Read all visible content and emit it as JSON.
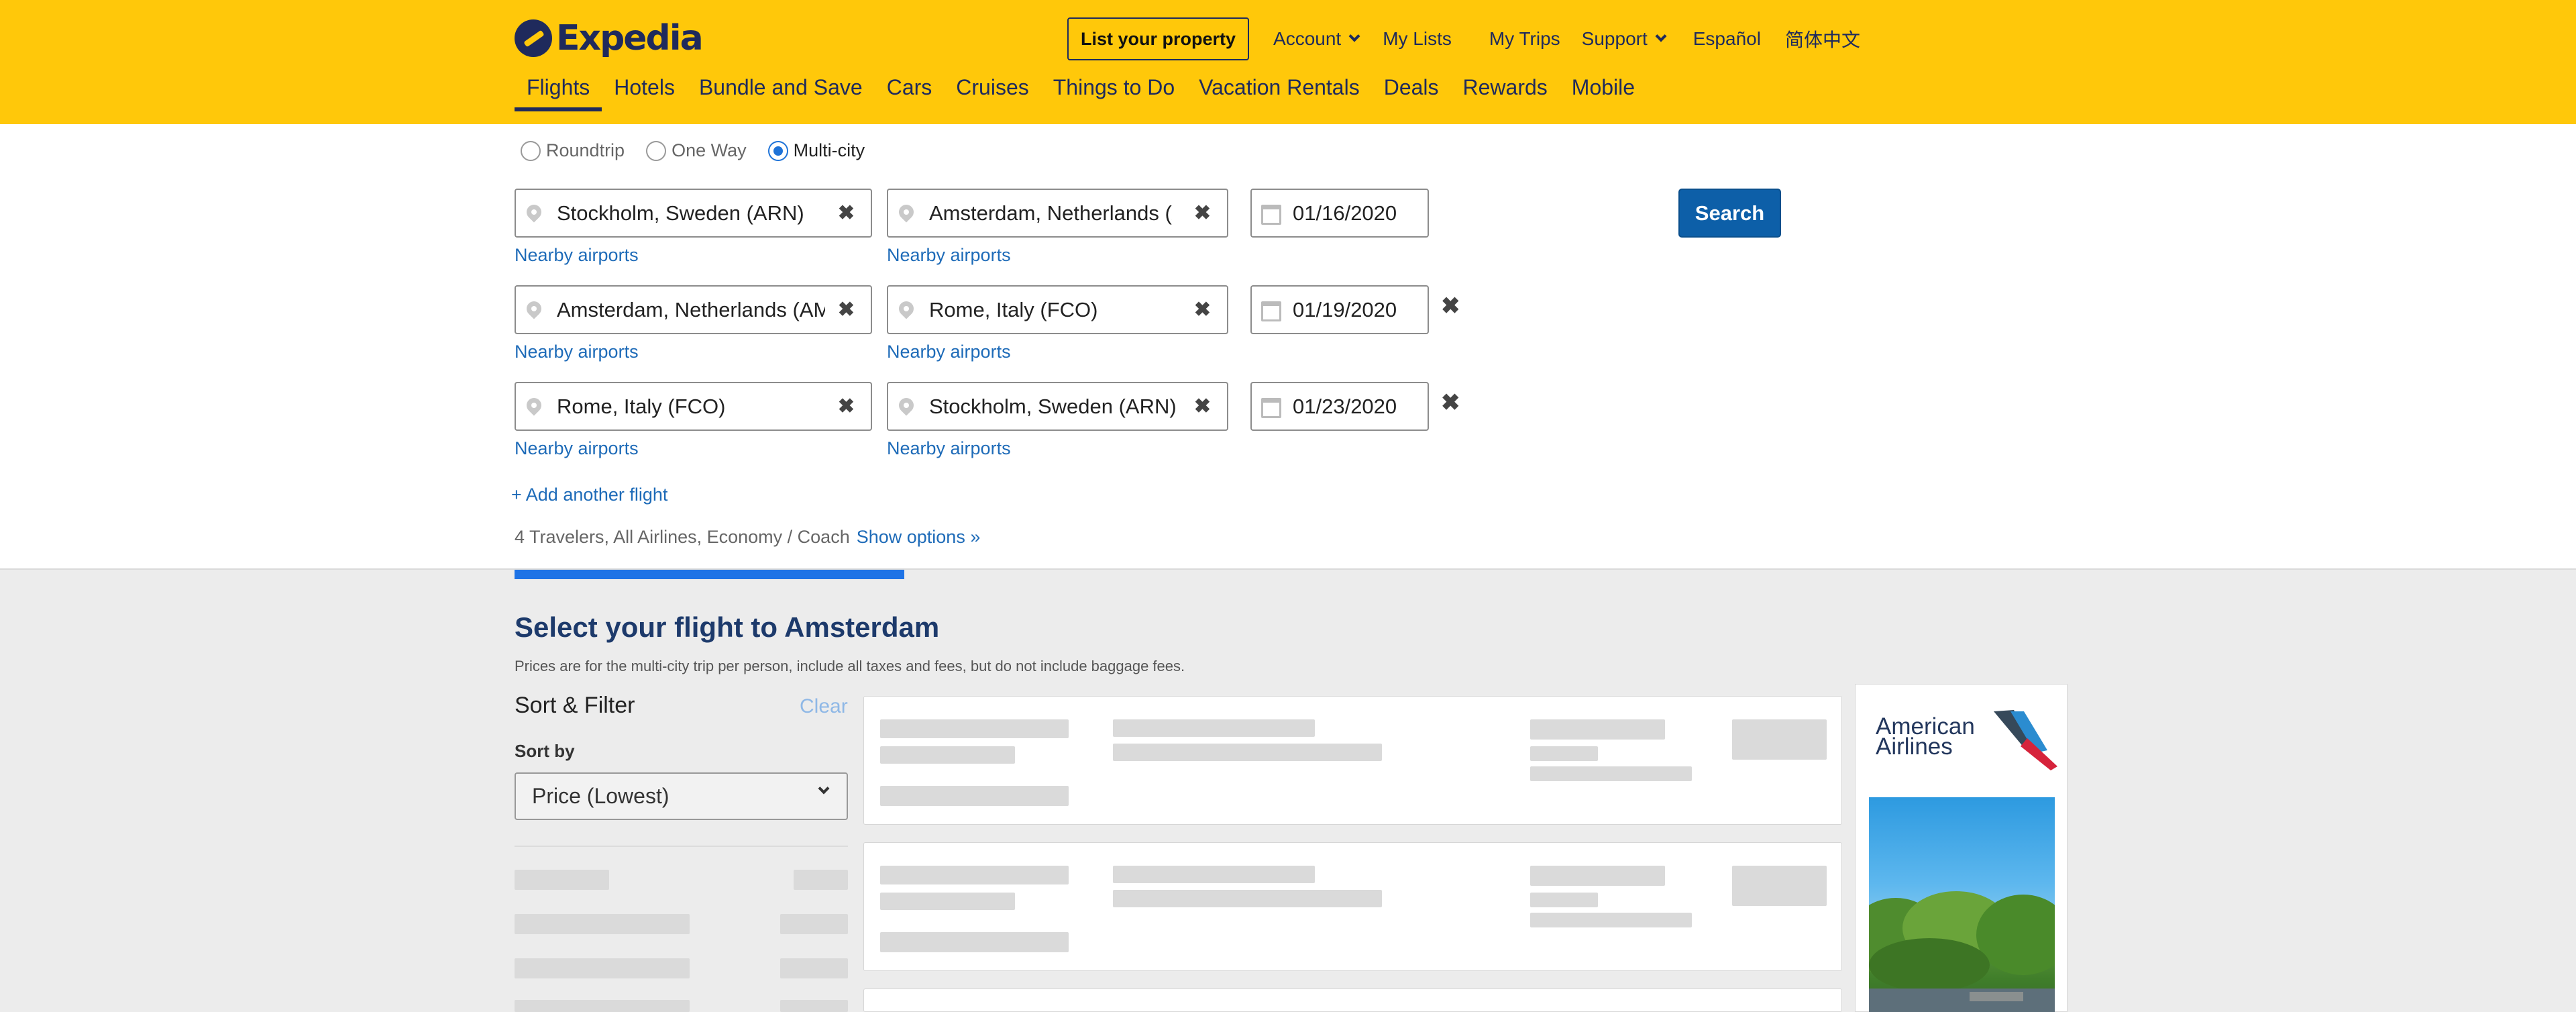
{
  "header": {
    "logo_text": "Expedia",
    "list_property": "List your property",
    "top_links": [
      "Account",
      "My Lists",
      "My Trips",
      "Support",
      "Español",
      "简体中文"
    ],
    "nav": [
      "Flights",
      "Hotels",
      "Bundle and Save",
      "Cars",
      "Cruises",
      "Things to Do",
      "Vacation Rentals",
      "Deals",
      "Rewards",
      "Mobile"
    ],
    "active_nav": "Flights"
  },
  "search": {
    "trip_types": [
      "Roundtrip",
      "One Way",
      "Multi-city"
    ],
    "selected_trip_type": "Multi-city",
    "flights": [
      {
        "from": "Stockholm, Sweden (ARN)",
        "to": "Amsterdam, Netherlands (A",
        "date": "01/16/2020"
      },
      {
        "from": "Amsterdam, Netherlands (AM",
        "to": "Rome, Italy (FCO)",
        "date": "01/19/2020"
      },
      {
        "from": "Rome, Italy (FCO)",
        "to": "Stockholm, Sweden (ARN)",
        "date": "01/23/2020"
      }
    ],
    "nearby_label": "Nearby airports",
    "clear_glyph": "✖",
    "remove_glyph": "✖",
    "search_button": "Search",
    "add_flight": "+ Add another flight",
    "options_summary": "4 Travelers, All Airlines, Economy / Coach",
    "show_options": "Show options »"
  },
  "results": {
    "title": "Select your flight to Amsterdam",
    "subtitle": "Prices are for the multi-city trip per person, include all taxes and fees, but do not include baggage fees.",
    "sort_filter": "Sort & Filter",
    "clear": "Clear",
    "sort_by_label": "Sort by",
    "sort_value": "Price (Lowest)"
  },
  "ad": {
    "brand": "American\nAirlines"
  },
  "colors": {
    "header_bg": "#ffc80a",
    "brand_navy": "#1f2a5c",
    "link_blue": "#1e6bb8",
    "search_button": "#0d5fa8",
    "progress": "#1e73e6"
  }
}
